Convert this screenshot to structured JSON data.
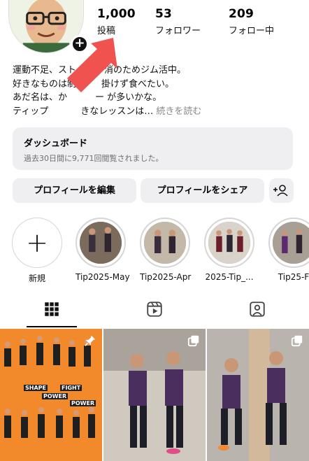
{
  "profile": {
    "stats": [
      {
        "value": "1,000",
        "label": "投稿"
      },
      {
        "value": "53",
        "label": "フォロワー"
      },
      {
        "value": "209",
        "label": "フォロー中"
      }
    ],
    "bio_lines": [
      "運動不足、スト",
      "好きなものは制",
      "あだ名は、か",
      "ティップ"
    ],
    "bio_tail": [
      "消のためジム活中。",
      "掛けず食べたい。",
      "ー が多いかな。",
      "きなレッスンは…"
    ],
    "bio_more": "続きを読む",
    "avatar_add": "+"
  },
  "dashboard": {
    "title": "ダッシュボード",
    "subtitle": "過去30日間に9,771回閲覧されました。"
  },
  "buttons": {
    "edit": "プロフィールを編集",
    "share": "プロフィールをシェア",
    "add_person_icon": "add-person-icon"
  },
  "highlights": [
    {
      "label": "新規"
    },
    {
      "label": "Tip2025-May"
    },
    {
      "label": "Tip2025-Apr"
    },
    {
      "label": "2025-Tip_..."
    },
    {
      "label": "Tip25-F"
    }
  ],
  "tabs": [
    {
      "icon": "grid-icon",
      "active": true
    },
    {
      "icon": "reels-icon",
      "active": false
    },
    {
      "icon": "tagged-icon",
      "active": false
    }
  ],
  "posts": [
    {
      "overlay_text": [
        "SHAPE",
        "POWER",
        "FIGHT",
        "POWER"
      ],
      "badge": "pin-icon",
      "bg": "#f28a2b"
    },
    {
      "badge": "carousel-icon",
      "bg": "#cfc9c0"
    },
    {
      "badge": "carousel-icon",
      "bg": "#b9b4ad"
    }
  ],
  "colors": {
    "accent_arrow": "#f0524f",
    "button_bg": "#efeff1",
    "muted_text": "#6f6f6f"
  }
}
